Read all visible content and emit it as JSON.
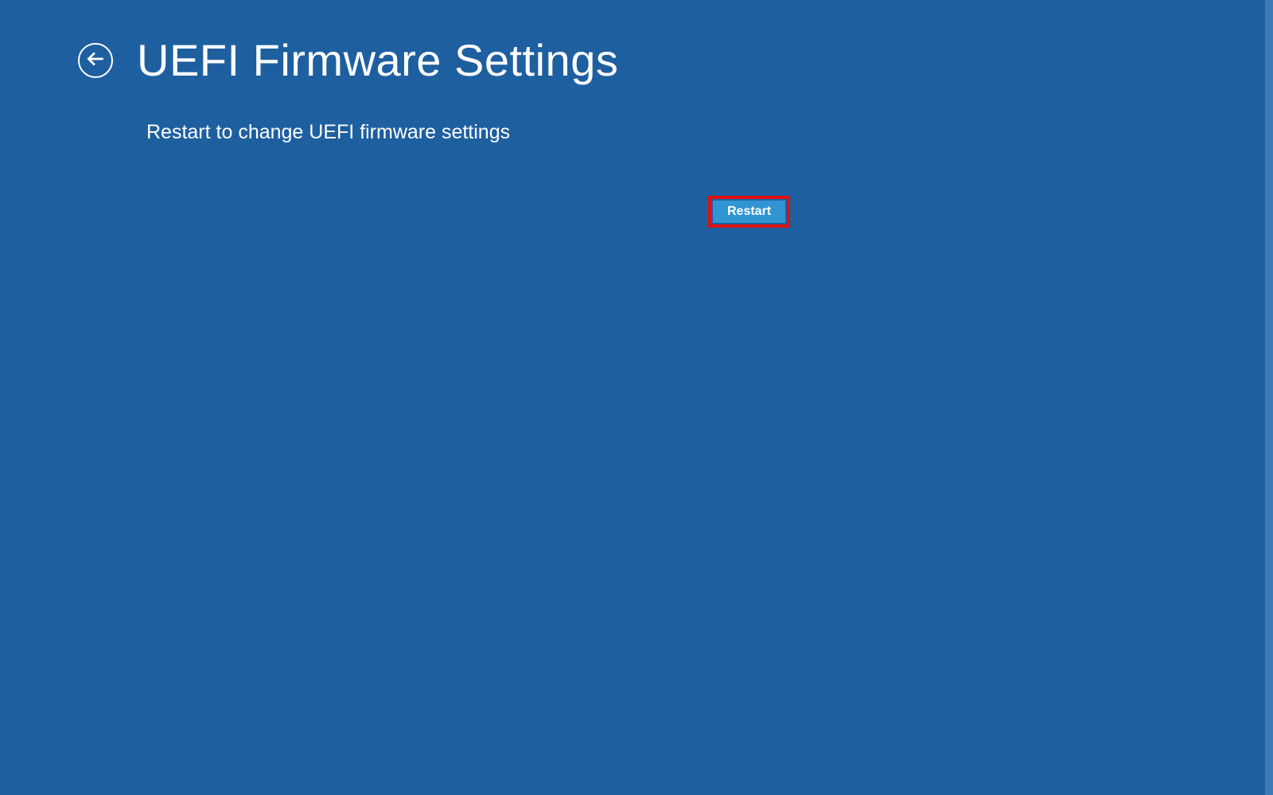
{
  "header": {
    "title": "UEFI Firmware Settings"
  },
  "content": {
    "description": "Restart to change UEFI firmware settings"
  },
  "buttons": {
    "restart_label": "Restart"
  }
}
